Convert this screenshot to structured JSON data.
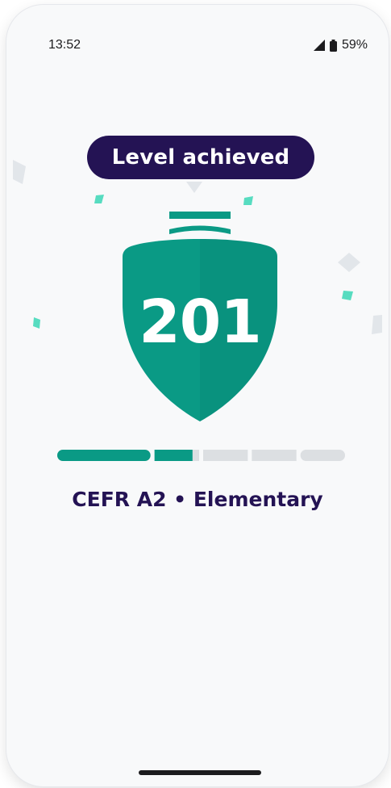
{
  "status_bar": {
    "time": "13:52",
    "battery_percent": "59%",
    "signal_icon": "cellular-signal-icon",
    "battery_icon": "battery-icon"
  },
  "level_badge": {
    "label": "Level achieved"
  },
  "shield": {
    "score": "201",
    "color": "#0a9a85",
    "icon": "shield-icon"
  },
  "progress": {
    "segments_total": 6,
    "filled_fraction": 0.47,
    "fill_color": "#0a9a85",
    "track_color": "#dcdfe2"
  },
  "cefr": {
    "text": "CEFR A2 • Elementary"
  },
  "colors": {
    "badge_bg": "#241354",
    "text_dark": "#241354",
    "confetti_teal": "#57dcc0",
    "confetti_grey": "#e2e6ea"
  }
}
